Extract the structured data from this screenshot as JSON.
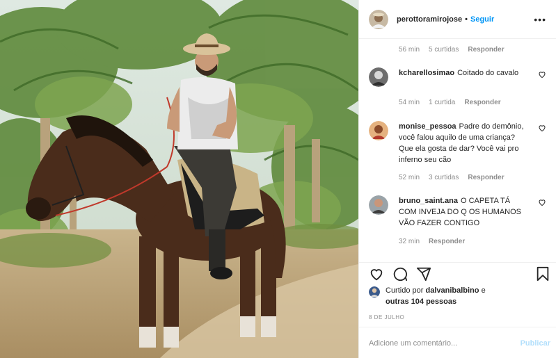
{
  "post": {
    "username": "perottoramirojose",
    "separator": "•",
    "follow_label": "Seguir",
    "more_label": "•••",
    "photo_alt": "Homem de chapéu montado em um cavalo marrom entre palmeiras"
  },
  "first_comment_meta": {
    "time": "56 min",
    "likes": "5 curtidas",
    "reply": "Responder"
  },
  "comments": [
    {
      "username": "kcharellosimao",
      "text": "Coitado do cavalo",
      "time": "54 min",
      "likes": "1 curtida",
      "reply": "Responder"
    },
    {
      "username": "monise_pessoa",
      "text": "Padre do demônio, você falou aquilo de uma criança? Que ela gosta de dar? Você vai pro inferno seu cão",
      "time": "52 min",
      "likes": "3 curtidas",
      "reply": "Responder"
    },
    {
      "username": "bruno_saint.ana",
      "text": "O CAPETA TÁ COM INVEJA DO Q OS HUMANOS VÃO FAZER CONTIGO",
      "time": "32 min",
      "reply": "Responder"
    }
  ],
  "likes": {
    "prefix": "Curtido por",
    "user": "dalvanibalbino",
    "joiner": "e",
    "others": "outras 104 pessoas"
  },
  "date": "8 DE JULHO",
  "add_comment": {
    "placeholder": "Adicione um comentário...",
    "publish_label": "Publicar"
  },
  "icons": {
    "like": "heart-icon",
    "comment": "comment-icon",
    "share": "send-icon",
    "save": "bookmark-icon"
  },
  "colors": {
    "follow": "#0095f6",
    "publish_disabled": "#b2dffc",
    "meta": "#8e8e8e",
    "text": "#262626"
  }
}
